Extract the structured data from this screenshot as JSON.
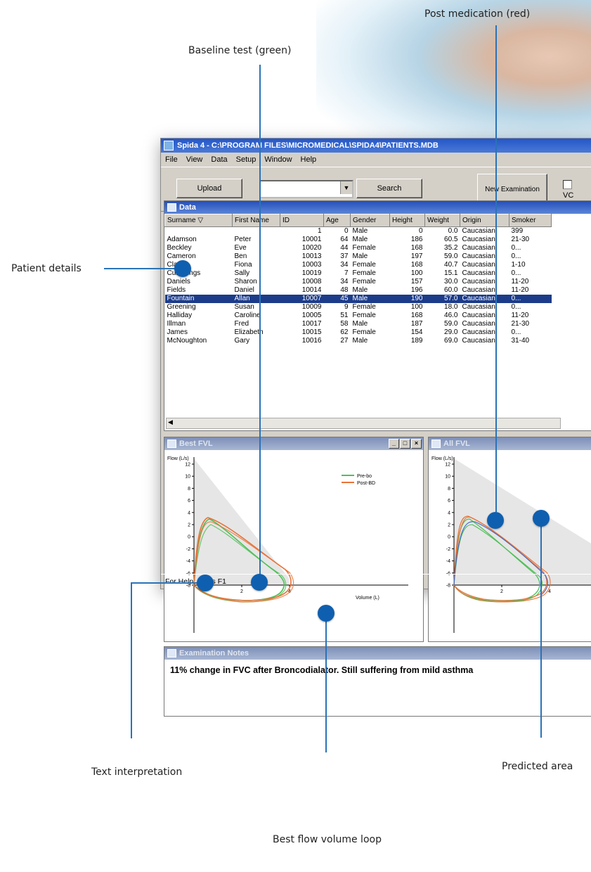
{
  "annotations": {
    "post_medication": "Post medication (red)",
    "baseline_test": "Baseline test (green)",
    "patient_details": "Patient details",
    "text_interpretation": "Text interpretation",
    "predicted_area": "Predicted area",
    "best_flow_volume_loop": "Best flow volume loop"
  },
  "window": {
    "title": "Spida 4 - C:\\PROGRAM FILES\\MICROMEDICAL\\SPIDA4\\PATIENTS.MDB",
    "menu": [
      "File",
      "View",
      "Data",
      "Setup",
      "Window",
      "Help"
    ],
    "toolbar": {
      "upload_label": "Upload",
      "search_label": "Search",
      "new_examination_label": "New Examination",
      "vc_label": "VC"
    },
    "data_panel": {
      "title": "Data",
      "columns": [
        "Surname ▽",
        "First Name",
        "ID",
        "Age",
        "Gender",
        "Height",
        "Weight",
        "Origin",
        "Smoker"
      ],
      "rows": [
        [
          "",
          "",
          "1",
          "0",
          "Male",
          "0",
          "0.0",
          "Caucasian",
          "399"
        ],
        [
          "Adamson",
          "Peter",
          "10001",
          "64",
          "Male",
          "186",
          "60.5",
          "Caucasian",
          "21-30"
        ],
        [
          "Beckley",
          "Eve",
          "10020",
          "44",
          "Female",
          "168",
          "35.2",
          "Caucasian",
          "0..."
        ],
        [
          "Cameron",
          "Ben",
          "10013",
          "37",
          "Male",
          "197",
          "59.0",
          "Caucasian",
          "0..."
        ],
        [
          "Clarke",
          "Fiona",
          "10003",
          "34",
          "Female",
          "168",
          "40.7",
          "Caucasian",
          "1-10"
        ],
        [
          "Cummings",
          "Sally",
          "10019",
          "7",
          "Female",
          "100",
          "15.1",
          "Caucasian",
          "0..."
        ],
        [
          "Daniels",
          "Sharon",
          "10008",
          "34",
          "Female",
          "157",
          "30.0",
          "Caucasian",
          "11-20"
        ],
        [
          "Fields",
          "Daniel",
          "10014",
          "48",
          "Male",
          "196",
          "60.0",
          "Caucasian",
          "11-20"
        ],
        [
          "Fountain",
          "Allan",
          "10007",
          "45",
          "Male",
          "190",
          "57.0",
          "Caucasian",
          "0..."
        ],
        [
          "Greening",
          "Susan",
          "10009",
          "9",
          "Female",
          "100",
          "18.0",
          "Caucasian",
          "0..."
        ],
        [
          "Halliday",
          "Caroline",
          "10005",
          "51",
          "Female",
          "168",
          "46.0",
          "Caucasian",
          "11-20"
        ],
        [
          "Illman",
          "Fred",
          "10017",
          "58",
          "Male",
          "187",
          "59.0",
          "Caucasian",
          "21-30"
        ],
        [
          "James",
          "Elizabeth",
          "10015",
          "62",
          "Female",
          "154",
          "29.0",
          "Caucasian",
          "0..."
        ],
        [
          "McNoughton",
          "Gary",
          "10016",
          "27",
          "Male",
          "189",
          "69.0",
          "Caucasian",
          "31-40"
        ]
      ],
      "selected_row": 8
    },
    "best_fvl_panel": {
      "title": "Best FVL",
      "y_label": "Flow (L/s)",
      "x_label": "Volume (L)",
      "legend": [
        "Pre-bo",
        "Post-BD"
      ],
      "y_ticks": [
        "12",
        "10",
        "8",
        "6",
        "4",
        "2",
        "0",
        "-2",
        "-4",
        "-6",
        "-8"
      ],
      "x_ticks": [
        "2",
        "4"
      ]
    },
    "all_fvl_panel": {
      "title": "All FVL",
      "y_label": "Flow (L/s)",
      "y_ticks": [
        "12",
        "10",
        "8",
        "6",
        "4",
        "2",
        "0",
        "-2",
        "-4",
        "-6",
        "-8"
      ],
      "x_ticks": [
        "2",
        "4"
      ]
    },
    "notes_panel": {
      "title": "Examination Notes",
      "text": "11% change in FVC after Broncodialator. Still suffering from mild asthma"
    },
    "status": "For Help, press F1"
  },
  "colors": {
    "baseline": "#4fbf58",
    "post_medication": "#e8733a",
    "callout_dot": "#0f5fb0",
    "callout_line": "#2a73b8",
    "predicted_area": "#e6e6e6"
  }
}
